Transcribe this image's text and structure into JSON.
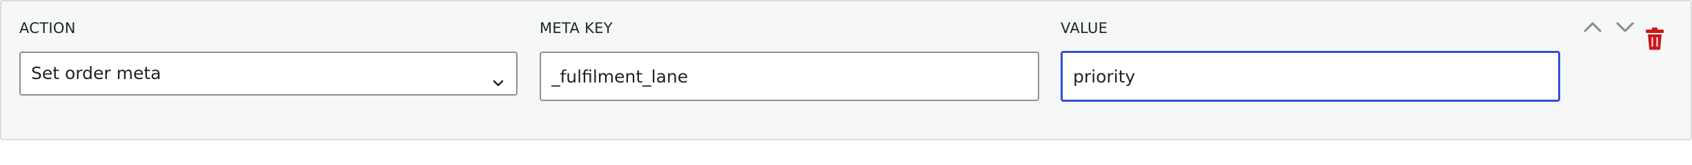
{
  "row": {
    "action_label": "ACTION",
    "meta_key_label": "META KEY",
    "value_label": "VALUE",
    "action_selected": "Set order meta",
    "meta_key_value": "_fulfilment_lane",
    "value_value": "priority"
  },
  "icons": {
    "move_up": "chevron-up-icon",
    "move_down": "chevron-down-icon",
    "delete": "trash-icon",
    "dropdown": "chevron-down-icon"
  },
  "colors": {
    "panel_bg": "#f6f7f7",
    "focus_border": "#2f4fd6",
    "delete_icon": "#cc1818",
    "move_icons": "#8c8f94"
  }
}
